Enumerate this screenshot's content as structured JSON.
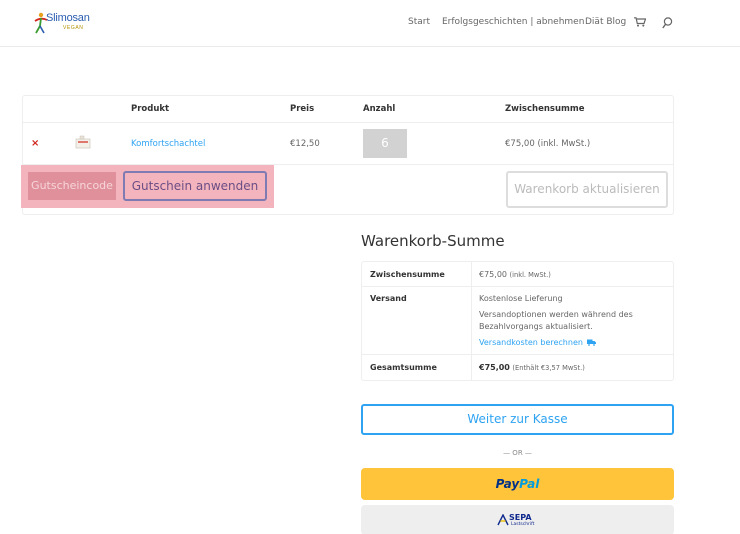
{
  "header": {
    "logo": {
      "brand_main": "Slimosan",
      "brand_sub": "VEGAN"
    },
    "nav": [
      "Start",
      "Erfolgsgeschichten | abnehmen",
      "Diät Blog"
    ],
    "icons": [
      "cart-icon",
      "search-icon"
    ]
  },
  "cart": {
    "columns": [
      "Produkt",
      "Preis",
      "Anzahl",
      "Zwischensumme"
    ],
    "items": [
      {
        "remove": "×",
        "product": "Komfortschachtel",
        "price": "€12,50",
        "quantity": "6",
        "subtotal": "€75,00 (inkl. MwSt.)"
      }
    ],
    "coupon_placeholder": "Gutscheincode",
    "coupon_button": "Gutschein anwenden",
    "update_button": "Warenkorb aktualisieren"
  },
  "totals": {
    "title": "Warenkorb-Summe",
    "subtotal_label": "Zwischensumme",
    "subtotal_value": "€75,00",
    "subtotal_tax": "(inkl. MwSt.)",
    "shipping_label": "Versand",
    "shipping_value": "Kostenlose Lieferung",
    "shipping_note_line1": "Versandoptionen werden während des",
    "shipping_note_line2": "Bezahlvorgangs aktualisiert.",
    "shipping_calc_link": "Versandkosten berechnen",
    "total_label": "Gesamtsumme",
    "total_value": "€75,00",
    "total_tax": "(Enthält €3,57 MwSt.)"
  },
  "checkout": {
    "button": "Weiter zur Kasse",
    "or": "— OR —",
    "paypal_pay": "Pay",
    "paypal_pal": "Pal",
    "sepa_title": "SEPA",
    "sepa_sub": "Lastschrift"
  },
  "colors": {
    "accent": "#2ea3f2",
    "remove": "#d0241b",
    "highlight": "#f4b4bd",
    "paypal": "#ffc439"
  }
}
